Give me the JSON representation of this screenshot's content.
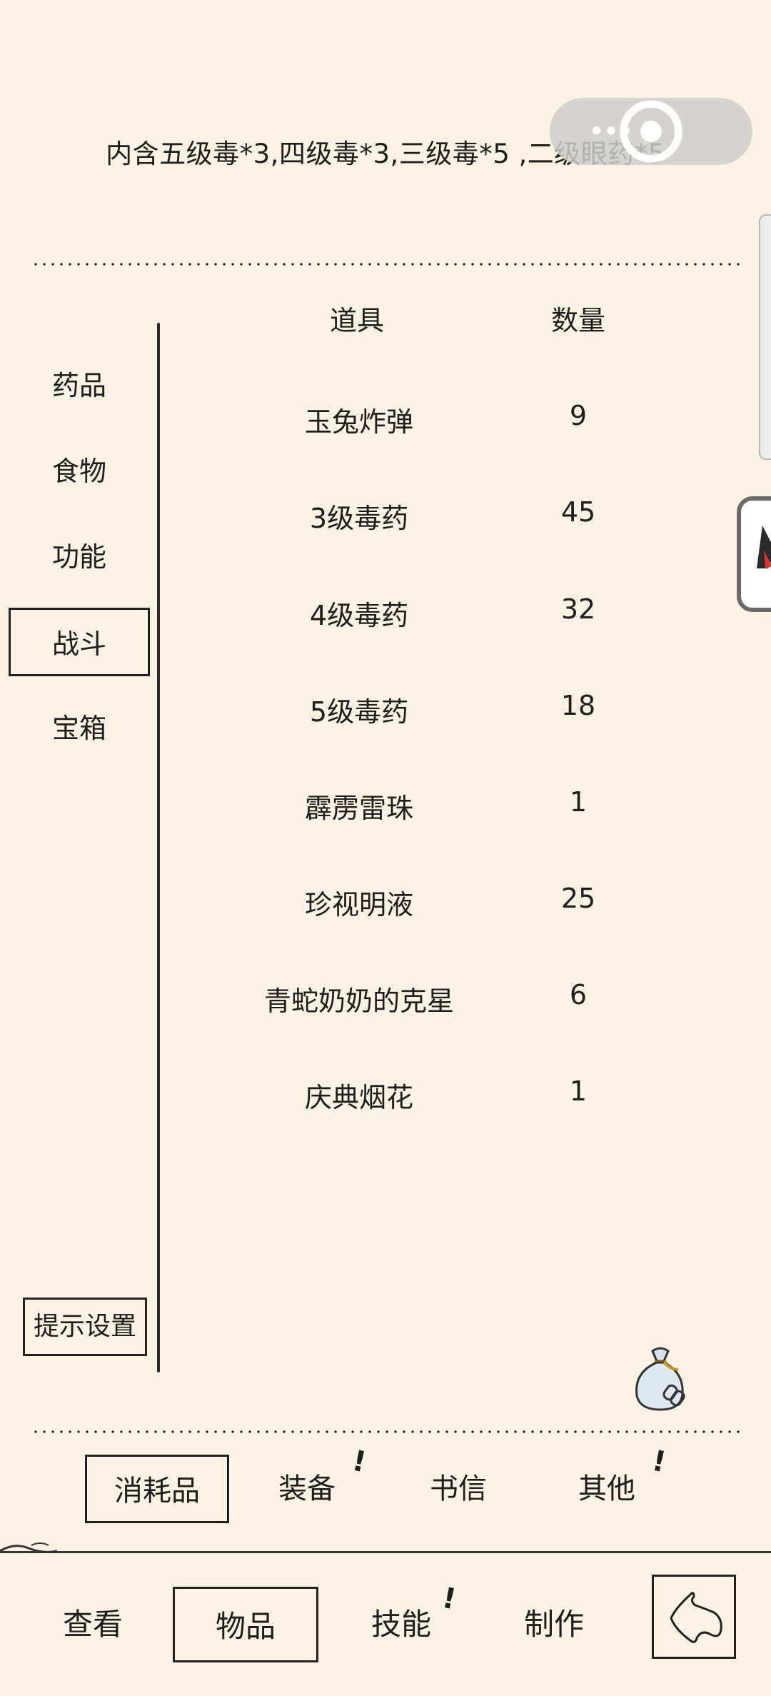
{
  "item_description": "内含五级毒*3,四级毒*3,三级毒*5 ,二级眼药*5",
  "capsule": {
    "more_icon": "more-dots-icon",
    "close_icon": "target-circle-icon"
  },
  "sidebar": {
    "categories": [
      {
        "label": "药品"
      },
      {
        "label": "食物"
      },
      {
        "label": "功能"
      },
      {
        "label": "战斗",
        "active": true
      },
      {
        "label": "宝箱"
      }
    ],
    "hint_settings": "提示设置"
  },
  "table": {
    "headers": {
      "item": "道具",
      "qty": "数量"
    },
    "rows": [
      {
        "name": "玉兔炸弹",
        "qty": "9"
      },
      {
        "name": "3级毒药",
        "qty": "45"
      },
      {
        "name": "4级毒药",
        "qty": "32"
      },
      {
        "name": "5级毒药",
        "qty": "18"
      },
      {
        "name": "霹雳雷珠",
        "qty": "1"
      },
      {
        "name": "珍视明液",
        "qty": "25"
      },
      {
        "name": "青蛇奶奶的克星",
        "qty": "6"
      },
      {
        "name": "庆典烟花",
        "qty": "1"
      }
    ]
  },
  "sub_tabs": [
    {
      "label": "消耗品",
      "active": true,
      "alert": false
    },
    {
      "label": "装备",
      "alert": true
    },
    {
      "label": "书信",
      "alert": false
    },
    {
      "label": "其他",
      "alert": true
    }
  ],
  "alert_mark": "!",
  "main_tabs": [
    {
      "label": "查看"
    },
    {
      "label": "物品",
      "active": true
    },
    {
      "label": "技能",
      "alert": true
    },
    {
      "label": "制作"
    }
  ],
  "icons": {
    "bag": "money-bag-icon",
    "back": "back-arrow-icon"
  },
  "colors": {
    "background": "#faf3e3",
    "ink": "#1e1e1e"
  }
}
